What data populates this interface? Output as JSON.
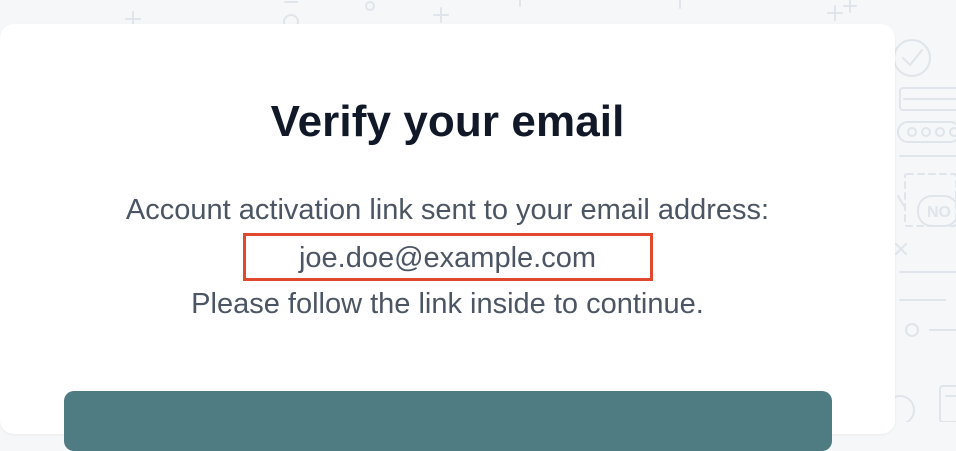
{
  "heading": {
    "title": "Verify your email"
  },
  "message": {
    "line1": "Account activation link sent to your email address:",
    "email": "joe.doe@example.com",
    "line3": "Please follow the link inside to continue."
  },
  "background_pattern": {
    "partial_label": "NO"
  },
  "colors": {
    "background": "#f5f7f9",
    "card": "#ffffff",
    "title": "#111827",
    "body_text": "#4b5563",
    "highlight_border": "#e0492e",
    "primary_button": "#4f7b82"
  }
}
